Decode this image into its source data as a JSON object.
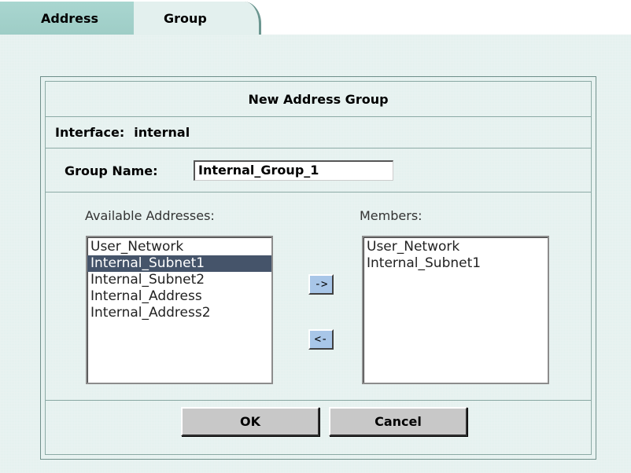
{
  "tabs": [
    {
      "label": "Address",
      "active": false
    },
    {
      "label": "Group",
      "active": true
    }
  ],
  "dialog": {
    "title": "New Address Group",
    "interface_label": "Interface:",
    "interface_value": "internal",
    "group_name_label": "Group Name:",
    "group_name_value": "Internal_Group_1",
    "available_label": "Available Addresses:",
    "members_label": "Members:",
    "available_items": [
      {
        "label": "User_Network",
        "selected": false
      },
      {
        "label": "Internal_Subnet1",
        "selected": true
      },
      {
        "label": "Internal_Subnet2",
        "selected": false
      },
      {
        "label": "Internal_Address",
        "selected": false
      },
      {
        "label": "Internal_Address2",
        "selected": false
      }
    ],
    "member_items": [
      {
        "label": "User_Network"
      },
      {
        "label": "Internal_Subnet1"
      }
    ],
    "add_button_label": "->",
    "remove_button_label": "<-",
    "ok_label": "OK",
    "cancel_label": "Cancel"
  },
  "colors": {
    "panel_bg": "#e2efed",
    "inactive_tab": "#a9d6d0",
    "selected_item_bg": "#45546a",
    "arrow_button_bg": "#a8c6e8",
    "dialog_button_bg": "#c8c8c8"
  }
}
